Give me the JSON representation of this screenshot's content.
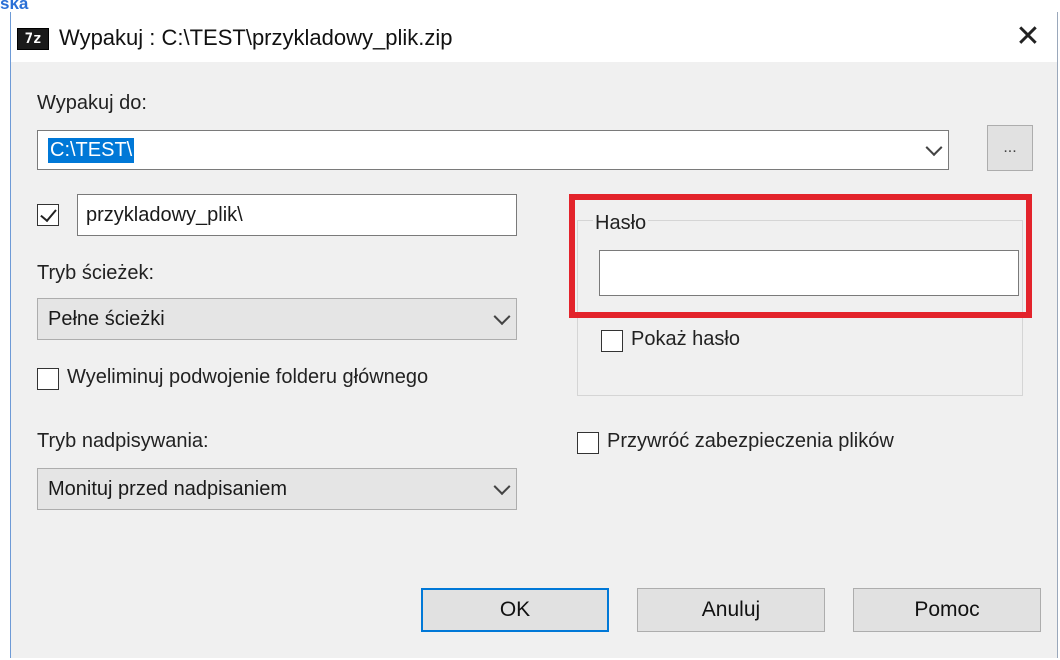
{
  "window": {
    "title": "Wypakuj : C:\\TEST\\przykladowy_plik.zip",
    "app_icon": "7z",
    "top_fragment": "ska"
  },
  "extract_to": {
    "label": "Wypakuj do:",
    "path": "C:\\TEST\\",
    "browse_label": "..."
  },
  "subfolder": {
    "checked": true,
    "value": "przykladowy_plik\\"
  },
  "path_mode": {
    "label": "Tryb ścieżek:",
    "selected": "Pełne ścieżki"
  },
  "eliminate_duplicates": {
    "label": "Wyeliminuj podwojenie folderu głównego",
    "checked": false
  },
  "overwrite_mode": {
    "label": "Tryb nadpisywania:",
    "selected": "Monituj przed nadpisaniem"
  },
  "password": {
    "label": "Hasło",
    "value": "",
    "show_label": "Pokaż hasło",
    "show_checked": false,
    "highlight_color": "#e3232b"
  },
  "restore_security": {
    "label": "Przywróć zabezpieczenia plików",
    "checked": false
  },
  "buttons": {
    "ok": "OK",
    "cancel": "Anuluj",
    "help": "Pomoc"
  },
  "colors": {
    "accent": "#0078d7",
    "dialog_bg": "#f0f0f0"
  }
}
